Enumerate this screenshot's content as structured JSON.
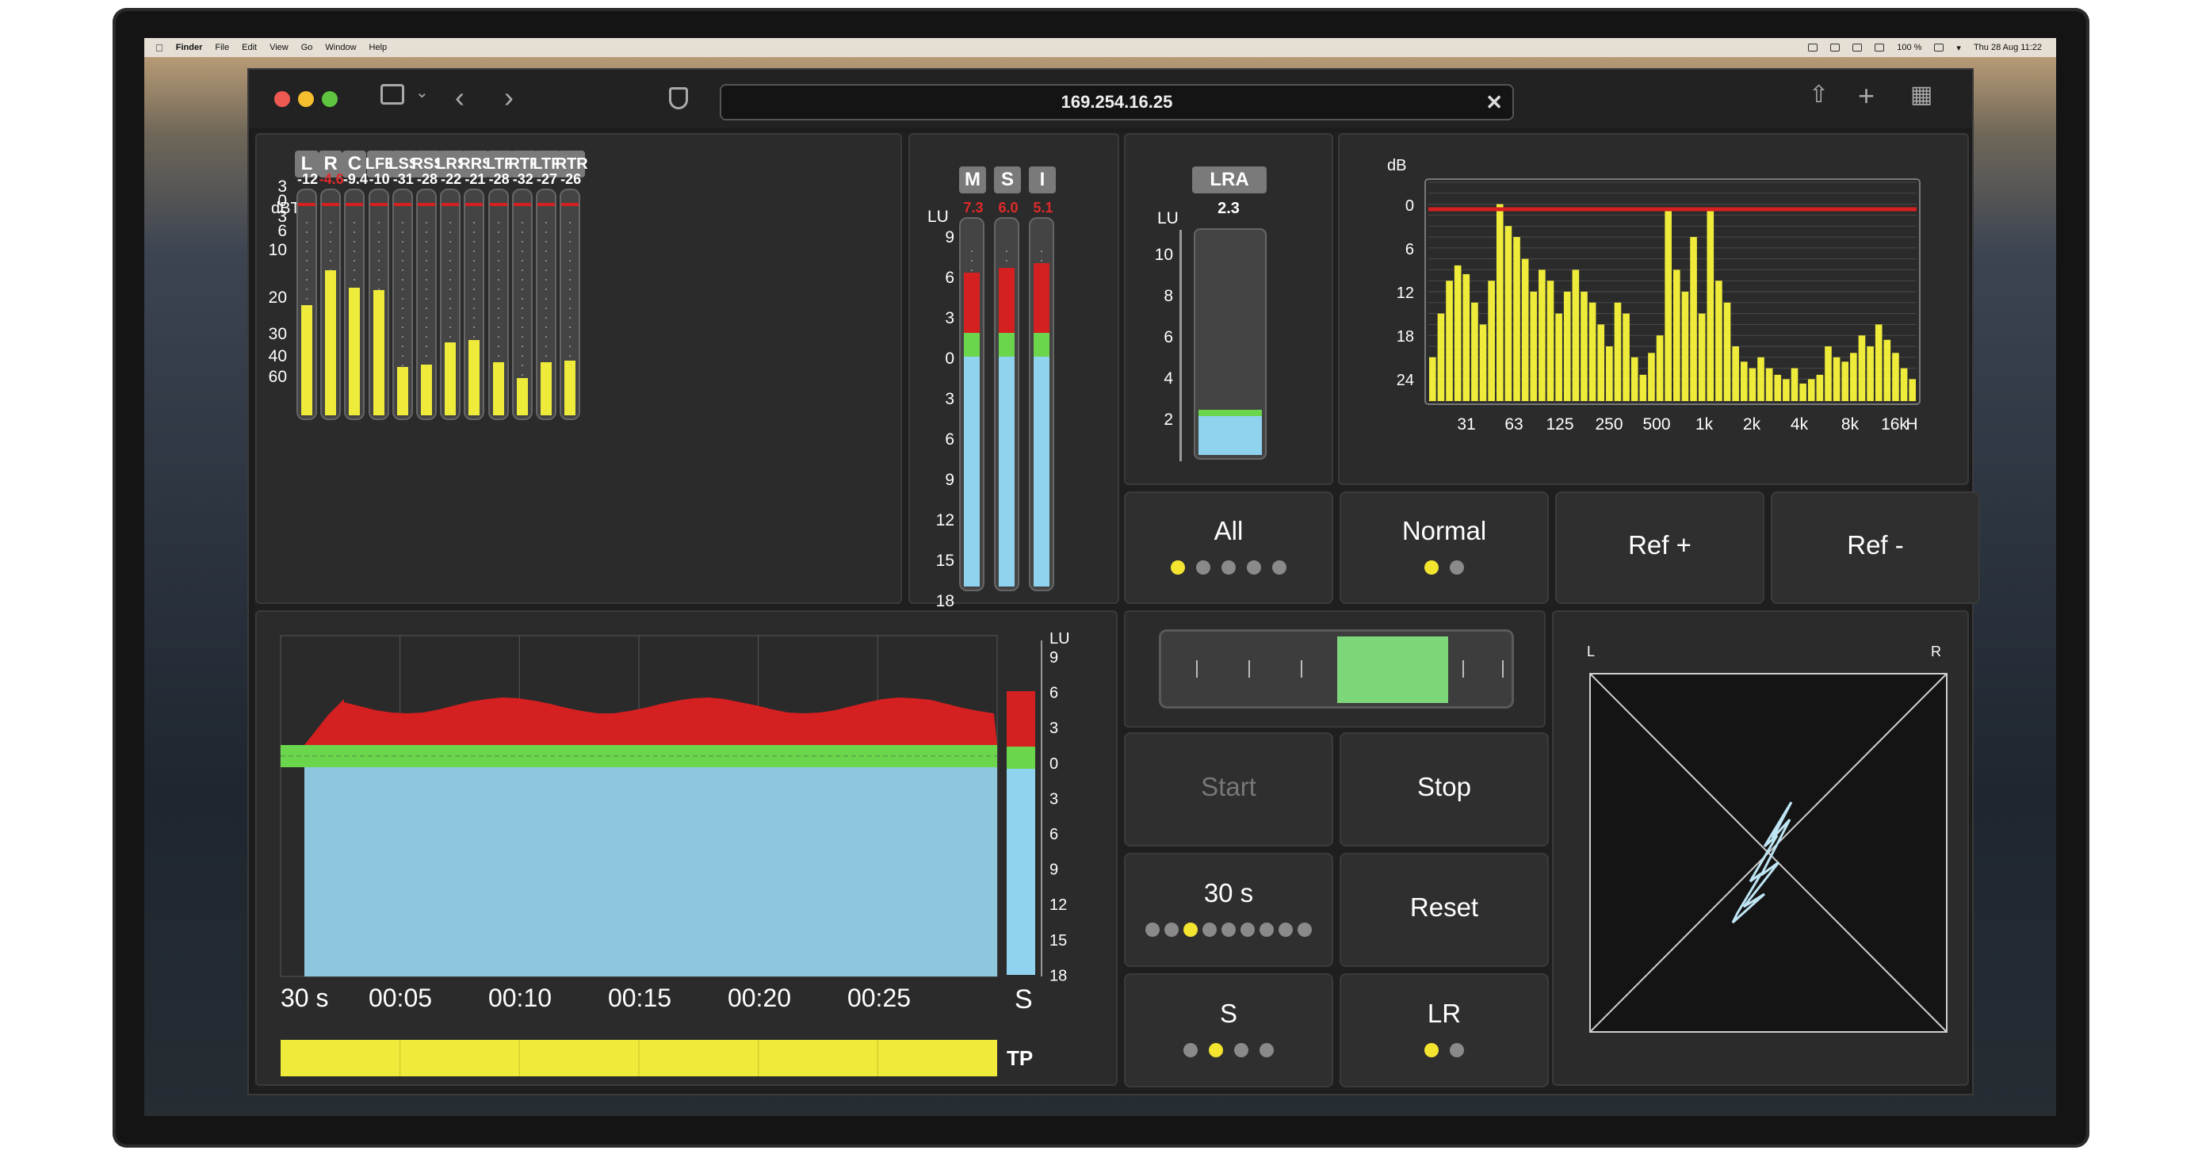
{
  "menubar": {
    "app": "Finder",
    "items": [
      "File",
      "Edit",
      "View",
      "Go",
      "Window",
      "Help"
    ],
    "battery": "100 %",
    "datetime": "Thu 28 Aug  11:22"
  },
  "browser": {
    "url": "169.254.16.25"
  },
  "true_peak": {
    "unit": "dBTP",
    "channels": [
      {
        "label": "L",
        "value": "-12",
        "red": false,
        "level": 0.5
      },
      {
        "label": "R",
        "value": "-4.6",
        "red": true,
        "level": 0.66
      },
      {
        "label": "C",
        "value": "-9.4",
        "red": false,
        "level": 0.58
      },
      {
        "label": "LFE",
        "value": "-10",
        "red": false,
        "level": 0.57
      },
      {
        "label": "LSS",
        "value": "-31",
        "red": false,
        "level": 0.22
      },
      {
        "label": "RSS",
        "value": "-28",
        "red": false,
        "level": 0.23
      },
      {
        "label": "LRS",
        "value": "-22",
        "red": false,
        "level": 0.33
      },
      {
        "label": "RRS",
        "value": "-21",
        "red": false,
        "level": 0.34
      },
      {
        "label": "LTF",
        "value": "-28",
        "red": false,
        "level": 0.24
      },
      {
        "label": "RTF",
        "value": "-32",
        "red": false,
        "level": 0.17
      },
      {
        "label": "LTR",
        "value": "-27",
        "red": false,
        "level": 0.24
      },
      {
        "label": "RTR",
        "value": "-26",
        "red": false,
        "level": 0.25
      }
    ],
    "scale": [
      "3",
      "0",
      "3",
      "6",
      "10",
      "20",
      "30",
      "40",
      "60"
    ]
  },
  "loudness": {
    "unit": "LU",
    "channels": [
      {
        "label": "M",
        "value": "7.3"
      },
      {
        "label": "S",
        "value": "6.0"
      },
      {
        "label": "I",
        "value": "5.1"
      }
    ],
    "scale": [
      "9",
      "6",
      "3",
      "0",
      "3",
      "6",
      "9",
      "12",
      "15",
      "18"
    ]
  },
  "lra": {
    "label": "LRA",
    "value": "2.3",
    "unit": "LU",
    "scale": [
      "10",
      "8",
      "6",
      "4",
      "2"
    ],
    "level": 0.2
  },
  "rta": {
    "unit": "dB",
    "y_ticks": [
      "0",
      "6",
      "12",
      "18",
      "24"
    ],
    "x_ticks": [
      "31",
      "63",
      "125",
      "250",
      "500",
      "1k",
      "2k",
      "4k",
      "8k",
      "16k",
      "H"
    ],
    "bars": [
      0.2,
      0.4,
      0.55,
      0.62,
      0.58,
      0.45,
      0.35,
      0.55,
      0.9,
      0.8,
      0.75,
      0.65,
      0.5,
      0.6,
      0.55,
      0.4,
      0.5,
      0.6,
      0.5,
      0.45,
      0.35,
      0.25,
      0.45,
      0.4,
      0.2,
      0.12,
      0.22,
      0.3,
      0.88,
      0.6,
      0.5,
      0.75,
      0.4,
      0.88,
      0.55,
      0.45,
      0.25,
      0.18,
      0.15,
      0.2,
      0.15,
      0.12,
      0.1,
      0.15,
      0.08,
      0.1,
      0.12,
      0.25,
      0.2,
      0.18,
      0.22,
      0.3,
      0.25,
      0.35,
      0.28,
      0.22,
      0.15,
      0.1
    ]
  },
  "mode_buttons": [
    {
      "label": "All",
      "dots": 5,
      "active": 0
    },
    {
      "label": "Normal",
      "dots": 2,
      "active": 0
    },
    {
      "label": "Ref +",
      "dots": 0,
      "active": -1
    },
    {
      "label": "Ref -",
      "dots": 0,
      "active": -1
    }
  ],
  "history": {
    "x_ticks": [
      "30 s",
      "00:05",
      "00:10",
      "00:15",
      "00:20",
      "00:25"
    ],
    "bar_label": "S",
    "y_unit": "LU",
    "y_ticks": [
      "9",
      "6",
      "3",
      "0",
      "3",
      "6",
      "9",
      "12",
      "15",
      "18"
    ],
    "tp_label": "TP"
  },
  "controls": [
    {
      "label": "Start",
      "disabled": true,
      "dots": 0,
      "active": -1
    },
    {
      "label": "Stop",
      "disabled": false,
      "dots": 0,
      "active": -1
    },
    {
      "label": "30 s",
      "disabled": false,
      "dots": 9,
      "active": 2
    },
    {
      "label": "Reset",
      "disabled": false,
      "dots": 0,
      "active": -1
    },
    {
      "label": "S",
      "disabled": false,
      "dots": 4,
      "active": 1
    },
    {
      "label": "LR",
      "disabled": false,
      "dots": 2,
      "active": 0
    }
  ],
  "goniometer": {
    "left": "L",
    "right": "R"
  },
  "colors": {
    "yellow": "#efeb3a",
    "red": "#d42020",
    "green": "#6bd64b",
    "blue": "#8fd3ef",
    "panel": "#2b2b2b"
  }
}
